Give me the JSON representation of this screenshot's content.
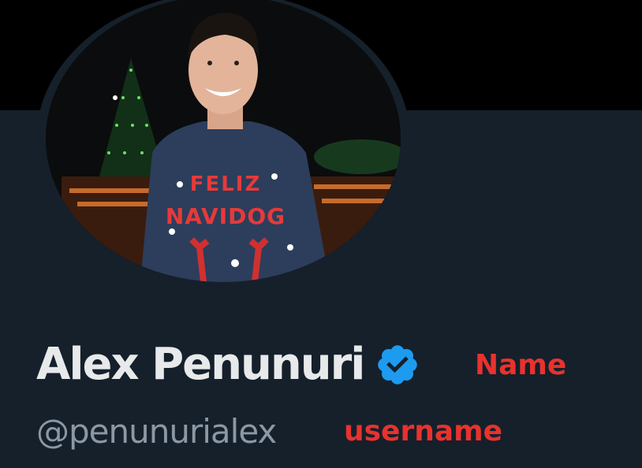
{
  "profile": {
    "display_name": "Alex Penunuri",
    "handle": "@penunurialex",
    "verified": true,
    "avatar_icon": "profile-photo",
    "sweater_text_line1": "FELIZ",
    "sweater_text_line2": "NAVIDOG"
  },
  "annotations": {
    "name_label": "Name",
    "username_label": "username"
  },
  "colors": {
    "background": "#15202b",
    "banner": "#000000",
    "name_text": "#e7e9ea",
    "handle_text": "#8b98a5",
    "verified_badge": "#1d9bf0",
    "annotation": "#e8322d"
  }
}
